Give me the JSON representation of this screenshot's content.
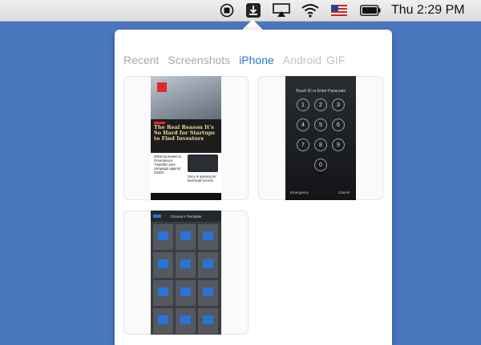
{
  "menubar": {
    "clock": "Thu 2:29 PM",
    "icons": [
      "record-icon",
      "download-app-icon",
      "airplay-icon",
      "wifi-icon",
      "us-flag-icon",
      "battery-icon"
    ]
  },
  "popover": {
    "tabs": [
      {
        "label": "Recent",
        "active": false
      },
      {
        "label": "Screenshots",
        "active": false
      },
      {
        "label": "iPhone",
        "active": true
      },
      {
        "label": "Android",
        "active": false
      },
      {
        "label": "GIF",
        "active": false
      }
    ]
  },
  "thumbnails": [
    {
      "kind": "news-app",
      "headline": "The Real Reason It's So Hard for Startups to Find Investors",
      "story1": "Nobel laureates to Greenpeace: 'Abandon your campaign against GMOs'",
      "story2": "Sony is opening its best-kept secrets"
    },
    {
      "kind": "passcode",
      "title": "Touch ID or Enter Passcode",
      "keys": [
        "1",
        "2",
        "3",
        "4",
        "5",
        "6",
        "7",
        "8",
        "9",
        "0"
      ],
      "left_action": "Emergency",
      "right_action": "Cancel"
    },
    {
      "kind": "template-chooser",
      "title": "Choose A Template"
    }
  ],
  "colors": {
    "accent": "#2a73d6",
    "desktop": "#4a78bf",
    "flipboard_red": "#e12828"
  }
}
